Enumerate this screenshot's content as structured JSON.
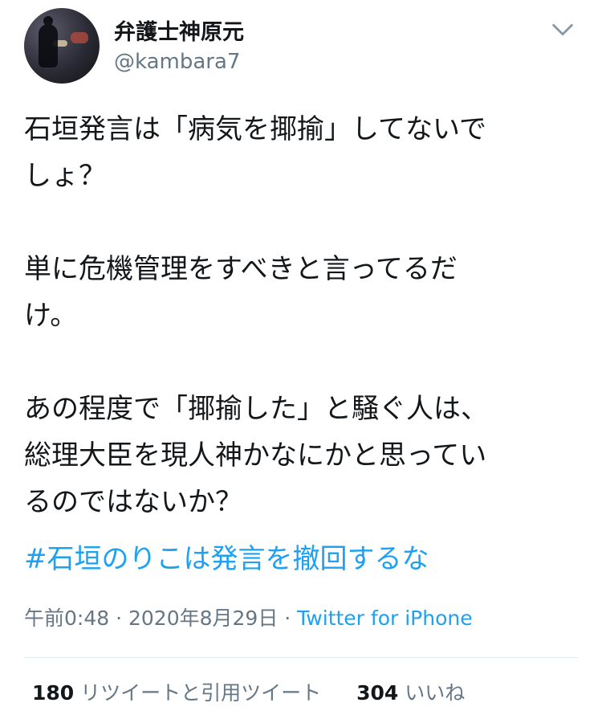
{
  "header": {
    "display_name": "弁護士神原元",
    "handle": "@kambara7"
  },
  "tweet": {
    "lines": [
      "石垣発言は「病気を揶揄」してないで",
      "しょ？",
      "",
      "単に危機管理をすべきと言ってるだ",
      "け。",
      "",
      "あの程度で「揶揄した」と騒ぐ人は、",
      "総理大臣を現人神かなにかと思ってい",
      "るのではないか？"
    ],
    "hashtag": "#石垣のりこは発言を撤回するな"
  },
  "meta": {
    "time": "午前0:48",
    "sep1": " · ",
    "date": "2020年8月29日",
    "sep2": " · ",
    "source": "Twitter for iPhone"
  },
  "stats": {
    "retweets": "180",
    "retweets_label": "リツイートと引用ツイート",
    "likes": "304",
    "likes_label": "いいね"
  },
  "colors": {
    "link": "#1da1f2",
    "secondary": "#657786",
    "text": "#14171a"
  },
  "icons": {
    "menu": "chevron-down-icon"
  }
}
